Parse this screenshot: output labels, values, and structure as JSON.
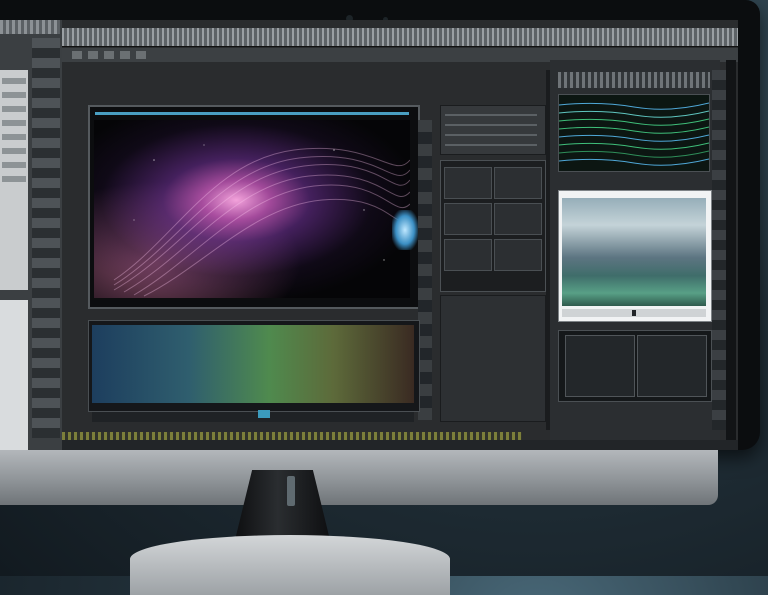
{
  "app": {
    "viewer": {
      "label": ""
    },
    "timeline": {
      "timecode": ""
    }
  },
  "colors": {
    "accent": "#3b9bbd",
    "panel_bg": "#2a2c2e",
    "bezel": "#0b0d0f",
    "waveform_green": "#3fbf7a",
    "waveform_blue": "#4fa8d8"
  },
  "icons": [
    "camera-icon"
  ]
}
